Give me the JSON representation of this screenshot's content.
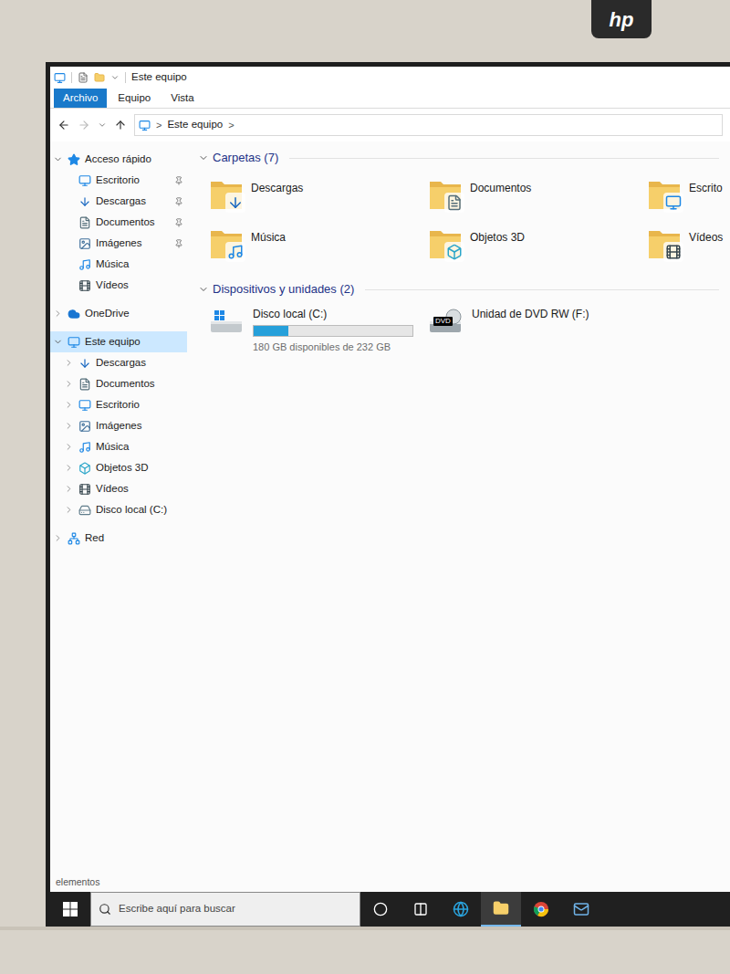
{
  "monitor": {
    "brand": "hp"
  },
  "window": {
    "title": "Este equipo"
  },
  "ribbon_tabs": [
    {
      "label": "Archivo",
      "selected": true
    },
    {
      "label": "Equipo",
      "selected": false
    },
    {
      "label": "Vista",
      "selected": false
    }
  ],
  "address_bar": {
    "crumbs": [
      "Este equipo"
    ],
    "separator": ">"
  },
  "sidebar": {
    "sections": [
      {
        "label": "Acceso rápido",
        "kind": "star",
        "expanded": true,
        "selected": false,
        "items": [
          {
            "label": "Escritorio",
            "kind": "desktop",
            "pinned": true
          },
          {
            "label": "Descargas",
            "kind": "downloads",
            "pinned": true
          },
          {
            "label": "Documentos",
            "kind": "documents",
            "pinned": true
          },
          {
            "label": "Imágenes",
            "kind": "pictures",
            "pinned": true
          },
          {
            "label": "Música",
            "kind": "music",
            "pinned": false
          },
          {
            "label": "Vídeos",
            "kind": "videos",
            "pinned": false
          }
        ]
      },
      {
        "label": "OneDrive",
        "kind": "cloud",
        "expanded": false,
        "selected": false,
        "items": []
      },
      {
        "label": "Este equipo",
        "kind": "computer",
        "expanded": true,
        "selected": true,
        "items": [
          {
            "label": "Descargas",
            "kind": "downloads",
            "expanded": false
          },
          {
            "label": "Documentos",
            "kind": "documents",
            "expanded": false
          },
          {
            "label": "Escritorio",
            "kind": "desktop",
            "expanded": false
          },
          {
            "label": "Imágenes",
            "kind": "pictures",
            "expanded": false
          },
          {
            "label": "Música",
            "kind": "music",
            "expanded": false
          },
          {
            "label": "Objetos 3D",
            "kind": "objects3d",
            "expanded": false
          },
          {
            "label": "Vídeos",
            "kind": "videos",
            "expanded": false
          },
          {
            "label": "Disco local (C:)",
            "kind": "disk",
            "expanded": false
          }
        ]
      },
      {
        "label": "Red",
        "kind": "network",
        "expanded": false,
        "selected": false,
        "items": []
      }
    ]
  },
  "content": {
    "groups": [
      {
        "title": "Carpetas (7)",
        "kind": "folders",
        "expanded": true,
        "items": [
          {
            "label": "Descargas",
            "kind": "downloads"
          },
          {
            "label": "Documentos",
            "kind": "documents"
          },
          {
            "label": "Escrito",
            "kind": "desktop"
          },
          {
            "label": "Música",
            "kind": "music"
          },
          {
            "label": "Objetos 3D",
            "kind": "objects3d"
          },
          {
            "label": "Vídeos",
            "kind": "videos"
          }
        ]
      },
      {
        "title": "Dispositivos y unidades (2)",
        "kind": "drives",
        "expanded": true,
        "items": [
          {
            "label": "Disco local (C:)",
            "kind": "disk",
            "level": 0.22,
            "detail": "180 GB disponibles de 232 GB"
          },
          {
            "label": "Unidad de DVD RW (F:)",
            "kind": "dvd",
            "badge": "DVD"
          }
        ]
      }
    ]
  },
  "status_bar": {
    "text": "elementos"
  },
  "taskbar": {
    "search_placeholder": "Escribe aquí para buscar",
    "apps": [
      {
        "kind": "cortana",
        "active": false
      },
      {
        "kind": "taskview",
        "active": false
      },
      {
        "kind": "browser",
        "active": false
      },
      {
        "kind": "explorer",
        "active": true
      },
      {
        "kind": "chrome",
        "active": false
      },
      {
        "kind": "mail",
        "active": false
      }
    ]
  }
}
